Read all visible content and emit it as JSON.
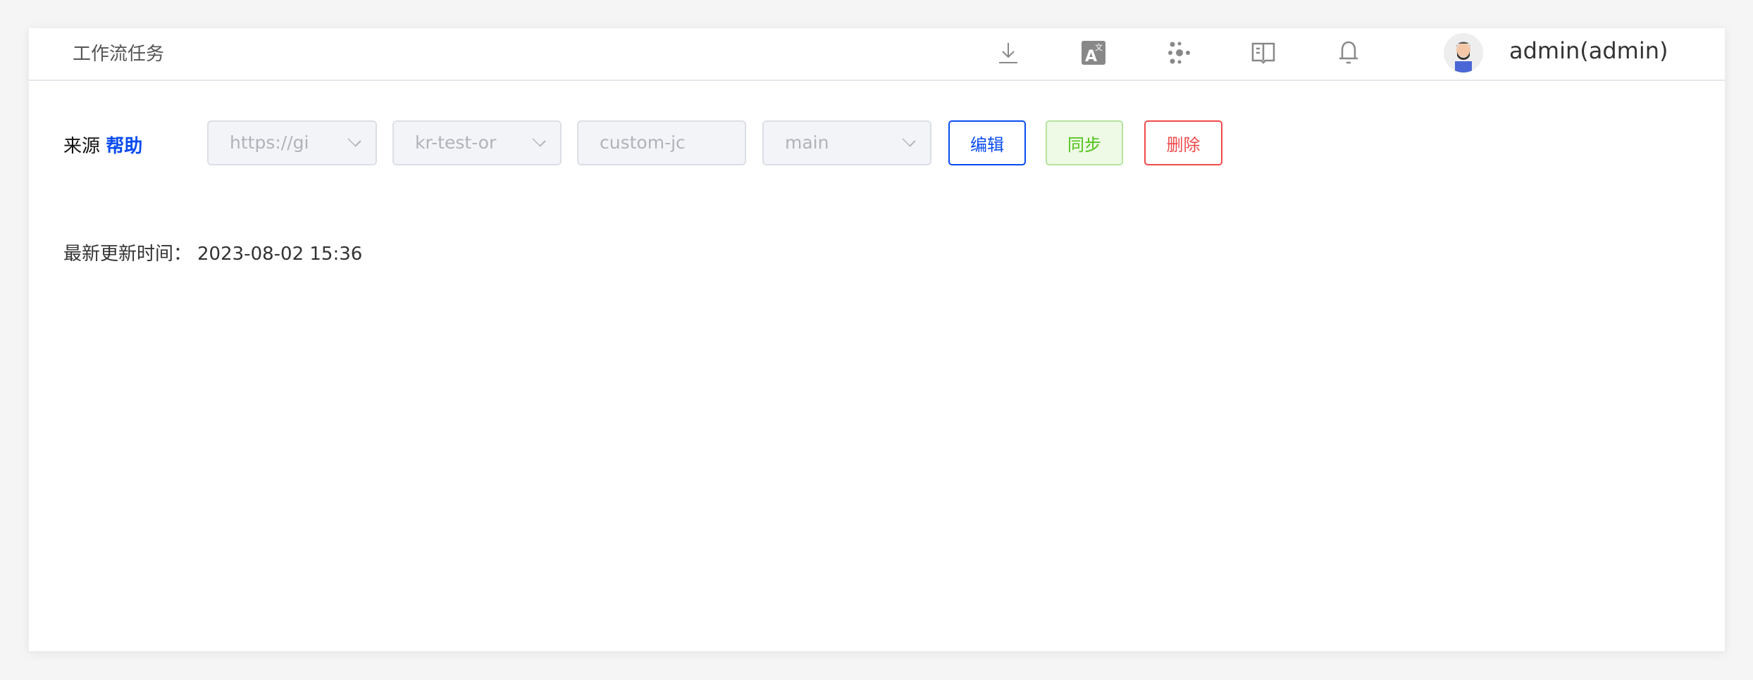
{
  "header": {
    "title": "工作流任务",
    "user": "admin(admin)",
    "icons": [
      "download-icon",
      "translate-icon",
      "graph-icon",
      "docs-icon",
      "bell-icon"
    ]
  },
  "source": {
    "label": "来源",
    "help": "帮助",
    "repo": "https://gi",
    "org": "kr-test-or",
    "job": "custom-jc",
    "branch": "main",
    "edit": "编辑",
    "sync": "同步",
    "delete": "删除"
  },
  "update": {
    "label": "最新更新时间：",
    "time": "2023-08-02 15:36"
  },
  "colors": {
    "primary": "#0a4cf0",
    "success": "#52c41a",
    "danger": "#f04b4b"
  }
}
